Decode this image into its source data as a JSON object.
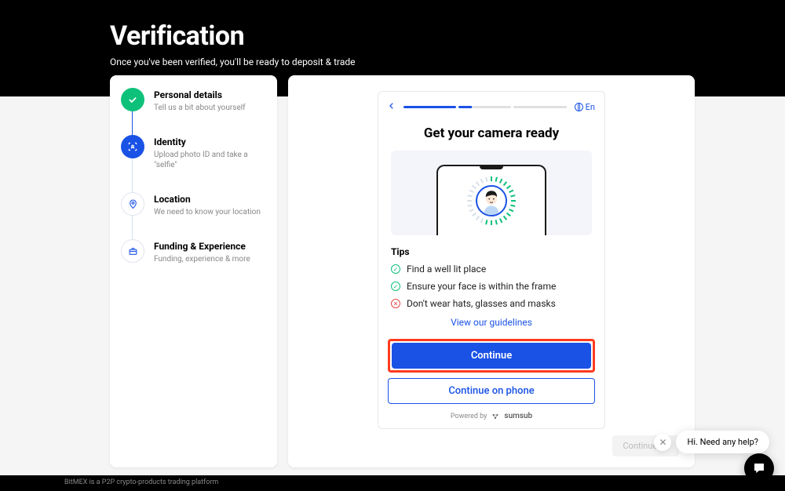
{
  "header": {
    "title": "Verification",
    "subtitle": "Once you've been verified, you'll be ready to deposit & trade"
  },
  "steps": [
    {
      "title": "Personal details",
      "sub": "Tell us a bit about yourself",
      "state": "complete"
    },
    {
      "title": "Identity",
      "sub": "Upload photo ID and take a \"selfie\"",
      "state": "active"
    },
    {
      "title": "Location",
      "sub": "We need to know your location",
      "state": "pending"
    },
    {
      "title": "Funding & Experience",
      "sub": "Funding, experience & more",
      "state": "pending"
    }
  ],
  "card": {
    "lang": "En",
    "title": "Get your camera ready",
    "tips_heading": "Tips",
    "tips": [
      {
        "text": "Find a well lit place",
        "kind": "ok"
      },
      {
        "text": "Ensure your face is within the frame",
        "kind": "ok"
      },
      {
        "text": "Don't wear hats, glasses and masks",
        "kind": "bad"
      }
    ],
    "guidelines": "View our guidelines",
    "continue": "Continue",
    "continue_phone": "Continue on phone",
    "powered": "Powered by",
    "provider": "sumsub"
  },
  "bottom_continue": "Continue  →",
  "help": {
    "text": "Hi. Need any help?"
  },
  "footer": "BitMEX is a P2P crypto-products trading platform"
}
